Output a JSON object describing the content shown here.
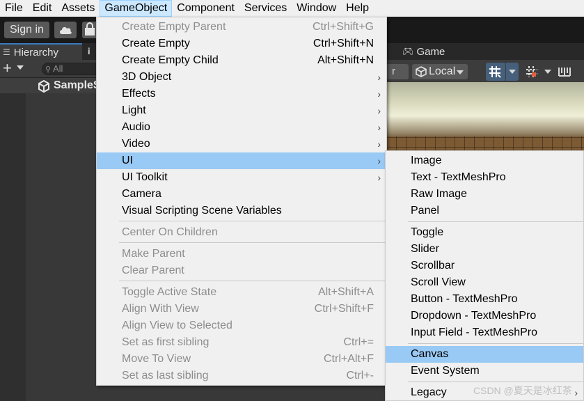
{
  "menubar": {
    "items": [
      {
        "label": "File"
      },
      {
        "label": "Edit"
      },
      {
        "label": "Assets"
      },
      {
        "label": "GameObject"
      },
      {
        "label": "Component"
      },
      {
        "label": "Services"
      },
      {
        "label": "Window"
      },
      {
        "label": "Help"
      }
    ],
    "active_index": 3
  },
  "toolbar": {
    "sign_in_label": "Sign in",
    "cloud_icon": "cloud-icon",
    "bag_icon": "bag-icon"
  },
  "hierarchy": {
    "tab_label": "Hierarchy",
    "tab_icon": "list-icon",
    "second_tab_icon": "info-icon",
    "second_tab_text": "i",
    "add_label": "+",
    "search_placeholder": "All",
    "scene_name": "SampleS"
  },
  "scene_panel": {
    "game_tab_label": "Game",
    "pivot_fragment": "r",
    "handle_mode_label": "Local"
  },
  "gameobject_menu": {
    "items": [
      {
        "label": "Create Empty Parent",
        "shortcut": "Ctrl+Shift+G",
        "disabled": true
      },
      {
        "label": "Create Empty",
        "shortcut": "Ctrl+Shift+N"
      },
      {
        "label": "Create Empty Child",
        "shortcut": "Alt+Shift+N"
      },
      {
        "label": "3D Object",
        "submenu": true
      },
      {
        "label": "Effects",
        "submenu": true
      },
      {
        "label": "Light",
        "submenu": true
      },
      {
        "label": "Audio",
        "submenu": true
      },
      {
        "label": "Video",
        "submenu": true
      },
      {
        "label": "UI",
        "submenu": true,
        "highlighted": true
      },
      {
        "label": "UI Toolkit",
        "submenu": true
      },
      {
        "label": "Camera"
      },
      {
        "label": "Visual Scripting Scene Variables"
      },
      {
        "label": "Center On Children",
        "disabled": true
      },
      {
        "label": "Make Parent",
        "disabled": true
      },
      {
        "label": "Clear Parent",
        "disabled": true
      },
      {
        "label": "Toggle Active State",
        "shortcut": "Alt+Shift+A",
        "disabled": true
      },
      {
        "label": "Align With View",
        "shortcut": "Ctrl+Shift+F",
        "disabled": true
      },
      {
        "label": "Align View to Selected",
        "disabled": true
      },
      {
        "label": "Set as first sibling",
        "shortcut": "Ctrl+=",
        "disabled": true
      },
      {
        "label": "Move To View",
        "shortcut": "Ctrl+Alt+F",
        "disabled": true
      },
      {
        "label": "Set as last sibling",
        "shortcut": "Ctrl+-",
        "disabled": true
      }
    ]
  },
  "ui_submenu": {
    "items": [
      {
        "label": "Image"
      },
      {
        "label": "Text - TextMeshPro"
      },
      {
        "label": "Raw Image"
      },
      {
        "label": "Panel"
      },
      {
        "label": "Toggle"
      },
      {
        "label": "Slider"
      },
      {
        "label": "Scrollbar"
      },
      {
        "label": "Scroll View"
      },
      {
        "label": "Button - TextMeshPro"
      },
      {
        "label": "Dropdown - TextMeshPro"
      },
      {
        "label": "Input Field - TextMeshPro"
      },
      {
        "label": "Canvas",
        "highlighted": true
      },
      {
        "label": "Event System"
      },
      {
        "label": "Legacy",
        "submenu": true
      }
    ]
  },
  "watermark": "CSDN @夏天是冰红茶",
  "colors": {
    "menu_highlight": "#99c9f5",
    "menubar_active": "#cce8ff",
    "editor_dark": "#383838",
    "toolbar_dark": "#191919",
    "grid_button_blue": "#46607c"
  }
}
